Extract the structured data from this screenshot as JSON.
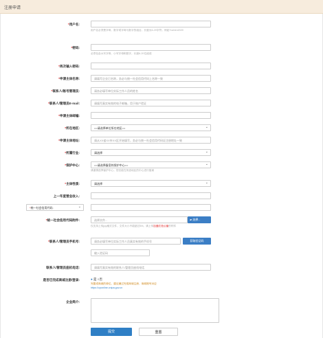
{
  "header": {
    "title": "注册申请"
  },
  "fields": {
    "username": {
      "label": "用户名:",
      "placeholder": ""
    },
    "username_hint": "用户名必须是字母、数字或字母与数字的组合，长度为6-20字符，例如Yuchen2020",
    "password": {
      "label": "密码:"
    },
    "password_hint": "必须包含大写字母、小写字母和数字，长度6-20位组成",
    "confirm_password": {
      "label": "再次输入密码:"
    },
    "applicant_name": {
      "label": "申请主体名称:",
      "placeholder": "请填写企业已名称，务必与统一社会信用代码上名称一致"
    },
    "contact": {
      "label": "联系人/账号管理员:",
      "placeholder": "请务必填写单位实际工作人员的姓名"
    },
    "email": {
      "label": "联系人/管理员E-mail:",
      "placeholder": "请填写真实有效的电子邮箱，用于账户验证"
    },
    "applicant_address": {
      "label": "申请主体邮编:"
    },
    "region": {
      "label": "所在地区:",
      "value": "==请选择单位所在地区=="
    },
    "detail_address": {
      "label": "申请主体地址:",
      "placeholder": "请从XX省XX市XX区开始填写，务必与统一社会信用代码证注册地址一致"
    },
    "industry": {
      "label": "所属行业:",
      "value": "请选择"
    },
    "protection_center": {
      "label": "保护中心:",
      "value": "==请选择备案的保护中心=="
    },
    "protection_hint": "请谨慎选择保护中心，您仅能在所选地区的中心进行备案",
    "entity_type": {
      "label": "主体性质:",
      "value": "请选择"
    },
    "last_year_revenue": {
      "label": "上一年度营业收入:"
    },
    "credit_code_type": {
      "value": "统一社会信用代码:"
    },
    "credit_file": {
      "label": "统一社会信用代码附件:",
      "placeholder": "选择文件...",
      "button": "选择..."
    },
    "credit_file_hint": "仅支持上传jpg格式文件，文件大小不能超过5M。请上传",
    "credit_file_hint_red": "加盖红色公章",
    "credit_file_hint_tail": "的附件",
    "phone": {
      "label": "联系人/管理员手机号:",
      "placeholder": "请务必填写单位实际工作人员真实有效的手机号",
      "button": "获取验证码"
    },
    "verify_code": {
      "placeholder": "输入验证码"
    },
    "landline": {
      "label": "联系人/管理员座机电话:",
      "placeholder": "请填写真实有效的联系人/管理员座机电话"
    },
    "registered": {
      "label": "是否已完成商城注册/登录:",
      "options": [
        "是",
        "否"
      ],
      "selected": "是"
    },
    "registered_hint": "完善或商城的单位，建议通过完成商城注册、商城账号对应",
    "registered_link": "https://cponline.cnipa.gov.cn",
    "intro": {
      "label": "企业简介:"
    }
  },
  "buttons": {
    "submit": "提交",
    "reset": "重置"
  },
  "colors": {
    "header_bg": "#f7ecdd",
    "primary": "#2f7fc5",
    "required": "#e02020"
  }
}
